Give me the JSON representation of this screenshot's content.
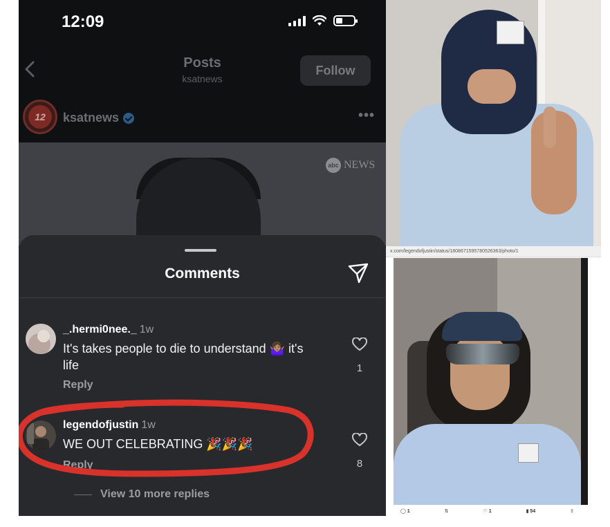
{
  "status_bar": {
    "time": "12:09"
  },
  "nav": {
    "title": "Posts",
    "subtitle": "ksatnews",
    "follow_label": "Follow",
    "back_icon": "chevron-left-icon"
  },
  "post": {
    "username": "ksatnews",
    "more_label": "•••",
    "watermark": "NEWS",
    "watermark_logo": "abc"
  },
  "comments_sheet": {
    "title": "Comments",
    "send_icon": "paper-plane-icon",
    "comments": [
      {
        "username": "_.hermi0nee._",
        "age": "1w",
        "text": "It's takes people to die to understand 🤷🏽‍♀️ it's life",
        "reply_label": "Reply",
        "likes": "1"
      },
      {
        "username": "legendofjustin",
        "age": "1w",
        "text": "WE OUT CELEBRATING 🎉🎉🎉",
        "reply_label": "Reply",
        "likes": "8"
      }
    ],
    "view_more_label": "View 10 more replies"
  },
  "colors": {
    "sheet_bg": "#27292d",
    "annotation_red": "#d8322b"
  },
  "right_panel": {
    "url_text": "x.com/legendofjustin/status/1808671595780526363/photo/1",
    "tweet_actions": [
      {
        "icon": "reply-icon",
        "count": "1"
      },
      {
        "icon": "retweet-icon",
        "count": ""
      },
      {
        "icon": "heart-icon",
        "count": "1"
      },
      {
        "icon": "views-icon",
        "count": "54"
      },
      {
        "icon": "share-icon",
        "count": ""
      }
    ]
  }
}
